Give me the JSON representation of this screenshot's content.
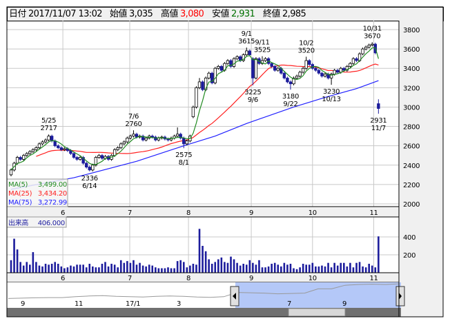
{
  "header": {
    "date_label": "日付",
    "date": "2017/11/07 13:02",
    "open_label": "始値",
    "open": "3,035",
    "high_label": "高値",
    "high": "3,080",
    "low_label": "安値",
    "low": "2,931",
    "close_label": "終値",
    "close": "2,985"
  },
  "colors": {
    "up": "#ffffff",
    "down": "#1c1c9c",
    "ma5": "#228b22",
    "ma25": "#ff2020",
    "ma75": "#2020ff",
    "volume": "#1c1c9c",
    "high_val": "#ff0000",
    "low_val": "#007000",
    "nav_fill": "#b4c8f8"
  },
  "legend": {
    "ma5_label": "MA(5)",
    "ma5_value": "3,499.00",
    "ma25_label": "MA(25)",
    "ma25_value": "3,434.20",
    "ma75_label": "MA(75)",
    "ma75_value": "3,272.99"
  },
  "volume_legend": {
    "label": "出来高",
    "value": "406.000"
  },
  "chart_data": {
    "type": "candlestick",
    "price_axis": {
      "ticks": [
        3800,
        3600,
        3400,
        3200,
        3000,
        2800,
        2600,
        2400,
        2200,
        2000
      ],
      "range": [
        2000,
        3800
      ]
    },
    "volume_axis": {
      "ticks": [
        400,
        200
      ],
      "range": [
        0,
        620
      ]
    },
    "month_ticks": [
      {
        "label": "6",
        "index": 16.5
      },
      {
        "label": "7",
        "index": 37.8
      },
      {
        "label": "8",
        "index": 56.5
      },
      {
        "label": "9",
        "index": 76.5
      },
      {
        "label": "10",
        "index": 96
      },
      {
        "label": "11",
        "index": 115.5
      }
    ],
    "ohlcv": [
      [
        2300,
        2365,
        2285,
        2350,
        140
      ],
      [
        2350,
        2435,
        2335,
        2420,
        380
      ],
      [
        2420,
        2495,
        2405,
        2480,
        260
      ],
      [
        2480,
        2495,
        2445,
        2460,
        120
      ],
      [
        2460,
        2515,
        2445,
        2500,
        80
      ],
      [
        2500,
        2535,
        2485,
        2520,
        120
      ],
      [
        2520,
        2555,
        2505,
        2540,
        90
      ],
      [
        2540,
        2575,
        2525,
        2560,
        230
      ],
      [
        2560,
        2595,
        2545,
        2580,
        120
      ],
      [
        2580,
        2635,
        2565,
        2620,
        80
      ],
      [
        2620,
        2655,
        2605,
        2640,
        70
      ],
      [
        2640,
        2675,
        2625,
        2660,
        100
      ],
      [
        2660,
        2717,
        2645,
        2700,
        90
      ],
      [
        2700,
        2715,
        2635,
        2650,
        100
      ],
      [
        2650,
        2665,
        2585,
        2600,
        120
      ],
      [
        2600,
        2615,
        2565,
        2580,
        100
      ],
      [
        2580,
        2595,
        2545,
        2560,
        70
      ],
      [
        2560,
        2585,
        2545,
        2570,
        50
      ],
      [
        2570,
        2585,
        2535,
        2550,
        60
      ],
      [
        2550,
        2565,
        2505,
        2520,
        80
      ],
      [
        2520,
        2535,
        2465,
        2480,
        70
      ],
      [
        2480,
        2495,
        2445,
        2460,
        90
      ],
      [
        2460,
        2495,
        2445,
        2480,
        90
      ],
      [
        2480,
        2495,
        2405,
        2420,
        90
      ],
      [
        2420,
        2435,
        2365,
        2380,
        60
      ],
      [
        2380,
        2395,
        2336,
        2350,
        100
      ],
      [
        2350,
        2415,
        2335,
        2400,
        70
      ],
      [
        2400,
        2495,
        2385,
        2480,
        60
      ],
      [
        2480,
        2515,
        2465,
        2500,
        60
      ],
      [
        2500,
        2515,
        2455,
        2470,
        100
      ],
      [
        2470,
        2505,
        2455,
        2490,
        120
      ],
      [
        2490,
        2505,
        2445,
        2460,
        70
      ],
      [
        2460,
        2515,
        2445,
        2500,
        100
      ],
      [
        2500,
        2575,
        2485,
        2560,
        90
      ],
      [
        2560,
        2595,
        2545,
        2580,
        60
      ],
      [
        2580,
        2635,
        2565,
        2620,
        140
      ],
      [
        2620,
        2655,
        2605,
        2640,
        110
      ],
      [
        2640,
        2695,
        2625,
        2680,
        130
      ],
      [
        2680,
        2715,
        2665,
        2700,
        110
      ],
      [
        2700,
        2760,
        2685,
        2720,
        140
      ],
      [
        2720,
        2735,
        2675,
        2690,
        90
      ],
      [
        2690,
        2715,
        2675,
        2700,
        110
      ],
      [
        2700,
        2715,
        2645,
        2660,
        80
      ],
      [
        2660,
        2695,
        2645,
        2680,
        70
      ],
      [
        2680,
        2715,
        2665,
        2700,
        90
      ],
      [
        2700,
        2715,
        2675,
        2690,
        80
      ],
      [
        2690,
        2705,
        2645,
        2660,
        60
      ],
      [
        2660,
        2695,
        2645,
        2680,
        50
      ],
      [
        2680,
        2705,
        2665,
        2690,
        50
      ],
      [
        2690,
        2705,
        2655,
        2670,
        50
      ],
      [
        2670,
        2685,
        2645,
        2660,
        60
      ],
      [
        2660,
        2695,
        2645,
        2680,
        50
      ],
      [
        2680,
        2715,
        2665,
        2700,
        50
      ],
      [
        2700,
        2790,
        2685,
        2720,
        130
      ],
      [
        2720,
        2735,
        2665,
        2680,
        140
      ],
      [
        2680,
        2695,
        2575,
        2620,
        120
      ],
      [
        2620,
        2665,
        2605,
        2650,
        60
      ],
      [
        2650,
        2715,
        2635,
        2700,
        80
      ],
      [
        2900,
        3015,
        2885,
        3000,
        100
      ],
      [
        3000,
        3215,
        2985,
        3200,
        90
      ],
      [
        3200,
        3300,
        3185,
        3260,
        490
      ],
      [
        3260,
        3275,
        3165,
        3180,
        300
      ],
      [
        3180,
        3315,
        3165,
        3300,
        240
      ],
      [
        3300,
        3365,
        3285,
        3350,
        150
      ],
      [
        3350,
        3365,
        3235,
        3250,
        100
      ],
      [
        3250,
        3415,
        3235,
        3400,
        120
      ],
      [
        3400,
        3435,
        3385,
        3420,
        150
      ],
      [
        3420,
        3435,
        3365,
        3380,
        170
      ],
      [
        3380,
        3465,
        3365,
        3450,
        120
      ],
      [
        3450,
        3495,
        3435,
        3480,
        110
      ],
      [
        3480,
        3495,
        3405,
        3420,
        180
      ],
      [
        3420,
        3515,
        3405,
        3500,
        150
      ],
      [
        3500,
        3535,
        3485,
        3520,
        110
      ],
      [
        3520,
        3535,
        3465,
        3480,
        80
      ],
      [
        3480,
        3555,
        3465,
        3540,
        100
      ],
      [
        3540,
        3615,
        3525,
        3580,
        90
      ],
      [
        3580,
        3595,
        3525,
        3540,
        140
      ],
      [
        3500,
        3515,
        3225,
        3300,
        110
      ],
      [
        3300,
        3515,
        3285,
        3500,
        90
      ],
      [
        3500,
        3515,
        3435,
        3450,
        140
      ],
      [
        3450,
        3525,
        3435,
        3480,
        60
      ],
      [
        3480,
        3515,
        3465,
        3500,
        60
      ],
      [
        3500,
        3515,
        3435,
        3450,
        70
      ],
      [
        3450,
        3465,
        3405,
        3420,
        100
      ],
      [
        3420,
        3435,
        3365,
        3380,
        110
      ],
      [
        3380,
        3415,
        3365,
        3400,
        90
      ],
      [
        3400,
        3415,
        3335,
        3350,
        70
      ],
      [
        3350,
        3365,
        3285,
        3300,
        110
      ],
      [
        3300,
        3315,
        3245,
        3260,
        90
      ],
      [
        3260,
        3275,
        3180,
        3240,
        100
      ],
      [
        3240,
        3315,
        3225,
        3300,
        50
      ],
      [
        3300,
        3335,
        3285,
        3320,
        40
      ],
      [
        3320,
        3375,
        3305,
        3360,
        60
      ],
      [
        3360,
        3415,
        3345,
        3400,
        100
      ],
      [
        3400,
        3520,
        3385,
        3480,
        90
      ],
      [
        3480,
        3495,
        3425,
        3440,
        90
      ],
      [
        3440,
        3455,
        3385,
        3400,
        110
      ],
      [
        3400,
        3415,
        3365,
        3380,
        70
      ],
      [
        3380,
        3395,
        3335,
        3350,
        70
      ],
      [
        3350,
        3365,
        3305,
        3320,
        80
      ],
      [
        3320,
        3355,
        3305,
        3340,
        70
      ],
      [
        3340,
        3355,
        3285,
        3300,
        110
      ],
      [
        3300,
        3355,
        3230,
        3340,
        60
      ],
      [
        3340,
        3395,
        3325,
        3380,
        110
      ],
      [
        3380,
        3395,
        3345,
        3360,
        80
      ],
      [
        3360,
        3415,
        3345,
        3400,
        110
      ],
      [
        3400,
        3415,
        3365,
        3380,
        110
      ],
      [
        3380,
        3435,
        3365,
        3420,
        70
      ],
      [
        3420,
        3465,
        3405,
        3450,
        110
      ],
      [
        3450,
        3515,
        3435,
        3500,
        60
      ],
      [
        3500,
        3515,
        3465,
        3480,
        110
      ],
      [
        3480,
        3565,
        3465,
        3550,
        120
      ],
      [
        3550,
        3615,
        3535,
        3600,
        70
      ],
      [
        3600,
        3635,
        3585,
        3620,
        60
      ],
      [
        3620,
        3655,
        3605,
        3640,
        100
      ],
      [
        3640,
        3670,
        3625,
        3650,
        80
      ],
      [
        3650,
        3665,
        3545,
        3560,
        60
      ],
      [
        3035,
        3080,
        2931,
        2985,
        406
      ]
    ],
    "ma75": [
      [
        0,
        2150
      ],
      [
        20,
        2270
      ],
      [
        40,
        2440
      ],
      [
        55,
        2600
      ],
      [
        65,
        2700
      ],
      [
        75,
        2830
      ],
      [
        90,
        3000
      ],
      [
        100,
        3100
      ],
      [
        110,
        3190
      ],
      [
        117,
        3273
      ]
    ],
    "annotations": [
      {
        "top": "5/25",
        "bottom": "2717",
        "index": 12,
        "price": 2717,
        "pos": "above"
      },
      {
        "top": "2336",
        "bottom": "6/14",
        "index": 25,
        "price": 2336,
        "pos": "below"
      },
      {
        "top": "7/6",
        "bottom": "2760",
        "index": 39,
        "price": 2760,
        "pos": "above"
      },
      {
        "top": "2575",
        "bottom": "8/1",
        "index": 55,
        "price": 2575,
        "pos": "below"
      },
      {
        "top": "9/1",
        "bottom": "3615",
        "index": 75,
        "price": 3615,
        "pos": "above"
      },
      {
        "top": "3225",
        "bottom": "9/6",
        "index": 77,
        "price": 3225,
        "pos": "below"
      },
      {
        "top": "9/11",
        "bottom": "3525",
        "index": 80,
        "price": 3525,
        "pos": "above"
      },
      {
        "top": "3180",
        "bottom": "9/22",
        "index": 89,
        "price": 3180,
        "pos": "below"
      },
      {
        "top": "10/2",
        "bottom": "3520",
        "index": 94,
        "price": 3520,
        "pos": "above"
      },
      {
        "top": "3230",
        "bottom": "10/13",
        "index": 102,
        "price": 3230,
        "pos": "below"
      },
      {
        "top": "10/31",
        "bottom": "3670",
        "index": 115,
        "price": 3670,
        "pos": "above"
      },
      {
        "top": "2931",
        "bottom": "11/7",
        "index": 117,
        "price": 2931,
        "pos": "below"
      }
    ]
  },
  "navigator": {
    "labels": [
      "9",
      "11",
      "17/1",
      "3",
      "7",
      "9"
    ],
    "history": [
      2250,
      2260,
      2270,
      2275,
      2275,
      2300,
      2320,
      2330,
      2310,
      2300,
      2290,
      2310,
      2320,
      2310,
      2290,
      2280,
      2300,
      2420,
      2410,
      2400,
      2380,
      2390,
      2400,
      2520,
      2520,
      2620,
      2640,
      2650,
      2640,
      2660
    ]
  }
}
